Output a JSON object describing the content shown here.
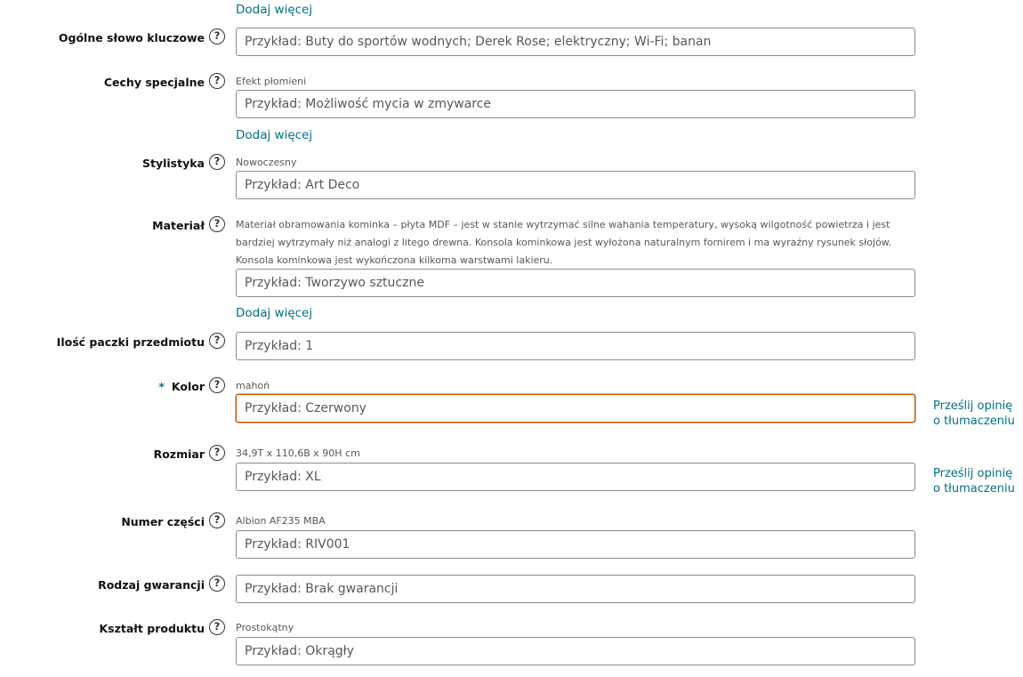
{
  "add_more_label": "Dodaj więcej",
  "feedback_label_line1": "Prześlij opinię",
  "feedback_label_line2": "o tłumaczeniu",
  "help_glyph": "?",
  "required_mark": "*",
  "fields": {
    "keyword": {
      "label": "Ogólne słowo kluczowe",
      "value_text": "",
      "placeholder": "Przykład: Buty do sportów wodnych; Derek Rose; elektryczny; Wi-Fi; banan"
    },
    "special_features": {
      "label": "Cechy specjalne",
      "value_text": "Efekt płomieni",
      "placeholder": "Przykład: Możliwość mycia w zmywarce"
    },
    "style": {
      "label": "Stylistyka",
      "value_text": "Nowoczesny",
      "placeholder": "Przykład: Art Deco"
    },
    "material": {
      "label": "Materiał",
      "value_text": "Materiał obramowania kominka – płyta MDF – jest w stanie wytrzymać silne wahania temperatury, wysoką wilgotność powietrza i jest bardziej wytrzymały niż analogi z litego drewna. Konsola kominkowa jest wyłożona naturalnym fornirem i ma wyraźny rysunek słojów. Konsola kominkowa jest wykończona kilkoma warstwami lakieru.",
      "placeholder": "Przykład: Tworzywo sztuczne"
    },
    "package_qty": {
      "label": "Ilość paczki przedmiotu",
      "value_text": "",
      "placeholder": "Przykład: 1"
    },
    "color": {
      "label": "Kolor",
      "value_text": "mahoń",
      "placeholder": "Przykład: Czerwony"
    },
    "size": {
      "label": "Rozmiar",
      "value_text": "34,9T x 110,6B x 90H cm",
      "placeholder": "Przykład: XL"
    },
    "part_number": {
      "label": "Numer części",
      "value_text": "Albion AF235 MBA",
      "placeholder": "Przykład: RIV001"
    },
    "warranty_type": {
      "label": "Rodzaj gwarancji",
      "value_text": "",
      "placeholder": "Przykład: Brak gwarancji"
    },
    "shape": {
      "label": "Kształt produktu",
      "value_text": "Prostokątny",
      "placeholder": "Przykład: Okrągły"
    }
  },
  "colors": {
    "link": "#007185",
    "focus_border": "#c45500",
    "border": "#888c8c"
  },
  "icons": {
    "help": "question-circle-icon"
  }
}
